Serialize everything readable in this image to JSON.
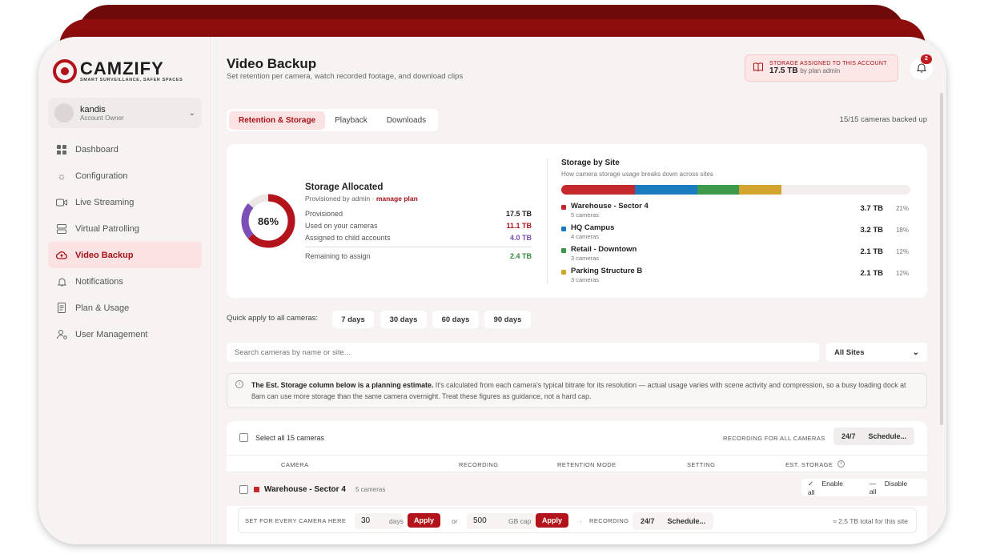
{
  "brand": {
    "name": "CAMZIFY",
    "tagline": "SMART SURVEILLANCE, SAFER SPACES",
    "accent": "#b3141b"
  },
  "user": {
    "name": "kandis",
    "role": "Account Owner"
  },
  "nav": [
    {
      "label": "Dashboard",
      "icon": "grid-icon"
    },
    {
      "label": "Configuration",
      "icon": "gear-icon"
    },
    {
      "label": "Live Streaming",
      "icon": "video-icon"
    },
    {
      "label": "Virtual Patrolling",
      "icon": "server-icon"
    },
    {
      "label": "Video Backup",
      "icon": "cloud-upload-icon",
      "active": true
    },
    {
      "label": "Notifications",
      "icon": "bell-icon"
    },
    {
      "label": "Plan & Usage",
      "icon": "document-icon"
    },
    {
      "label": "User Management",
      "icon": "user-gear-icon"
    }
  ],
  "header": {
    "title": "Video Backup",
    "subtitle": "Set retention per camera, watch recorded footage, and download clips",
    "storage_label": "STORAGE ASSIGNED TO THIS ACCOUNT",
    "storage_value": "17.5 TB",
    "storage_by": "by plan admin",
    "notifications_count": "2"
  },
  "tabs": [
    "Retention & Storage",
    "Playback",
    "Downloads"
  ],
  "backed_up": "15/15 cameras backed up",
  "allocation": {
    "percent_label": "86%",
    "percent": 86,
    "title": "Storage Allocated",
    "sub": "Provisioned by admin · ",
    "manage_link": "manage plan",
    "rows": [
      {
        "label": "Provisioned",
        "value": "17.5 TB",
        "color": "#222222"
      },
      {
        "label": "Used on your cameras",
        "value": "11.1 TB",
        "color": "#b3141b"
      },
      {
        "label": "Assigned to child accounts",
        "value": "4.0 TB",
        "color": "#7b4fb5"
      }
    ],
    "remaining_label": "Remaining to assign",
    "remaining_value": "2.4 TB"
  },
  "sites": {
    "title": "Storage by Site",
    "subtitle": "How camera storage usage breaks down across sites",
    "items": [
      {
        "name": "Warehouse - Sector 4",
        "cameras": "5 cameras",
        "tb": "3.7 TB",
        "pct": "21%",
        "share": 21,
        "color": "#c4282d"
      },
      {
        "name": "HQ Campus",
        "cameras": "4 cameras",
        "tb": "3.2 TB",
        "pct": "18%",
        "share": 18,
        "color": "#1a7bbf"
      },
      {
        "name": "Retail - Downtown",
        "cameras": "3 cameras",
        "tb": "2.1 TB",
        "pct": "12%",
        "share": 12,
        "color": "#3c9a4a"
      },
      {
        "name": "Parking Structure B",
        "cameras": "3 cameras",
        "tb": "2.1 TB",
        "pct": "12%",
        "share": 12,
        "color": "#d4a52c"
      }
    ]
  },
  "quick": {
    "label": "Quick apply to all cameras:",
    "options": [
      "7 days",
      "30 days",
      "60 days",
      "90 days"
    ]
  },
  "search": {
    "placeholder": "Search cameras by name or site..."
  },
  "site_filter": "All Sites",
  "notice": {
    "bold": "The Est. Storage column below is a planning estimate.",
    "text": " It's calculated from each camera's typical bitrate for its resolution — actual usage varies with scene activity and compression, so a busy loading dock at 8am can use more storage than the same camera overnight. Treat these figures as guidance, not a hard cap."
  },
  "table": {
    "select_all": "Select all 15 cameras",
    "recording_all": "RECORDING FOR ALL CAMERAS",
    "rec_options": [
      "24/7",
      "Schedule..."
    ],
    "columns": [
      "CAMERA",
      "RECORDING",
      "RETENTION MODE",
      "SETTING",
      "EST. STORAGE"
    ],
    "group": {
      "name": "Warehouse - Sector 4",
      "count": "5 cameras",
      "enable_all": "Enable all",
      "disable_all": "Disable all",
      "set_label": "SET FOR EVERY CAMERA HERE",
      "days_value": "30",
      "days_unit": "days",
      "apply": "Apply",
      "or": "or",
      "gb_value": "500",
      "gb_unit": "GB cap",
      "recording_label": "RECORDING",
      "total": "≈ 2.5 TB total for this site"
    }
  }
}
